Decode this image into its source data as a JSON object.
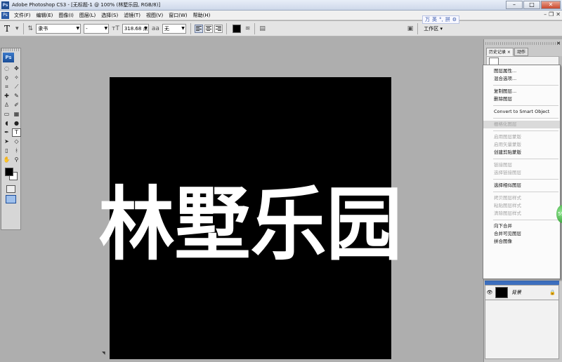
{
  "window": {
    "title": "Adobe Photoshop CS3 - [无标题-1 @ 100% (林墅乐园, RGB/8)]",
    "app_icon": "Ps",
    "buttons": {
      "minimize": "–",
      "maximize": "□",
      "close": "✕"
    }
  },
  "menu": {
    "items": [
      "文件(F)",
      "编辑(E)",
      "图像(I)",
      "图层(L)",
      "选择(S)",
      "滤镜(T)",
      "视图(V)",
      "窗口(W)",
      "帮助(H)"
    ],
    "window_controls": [
      "–",
      "❐",
      "✕"
    ]
  },
  "options_bar": {
    "tool_glyph": "T",
    "font_family": "隶书",
    "font_style": "-",
    "font_size": "318.68 点",
    "antialias": "无",
    "workspace": "工作区"
  },
  "ime_bar": {
    "items": [
      "万",
      "英",
      "°,",
      "拼",
      "⚙"
    ]
  },
  "toolbox": {
    "badge": "Ps"
  },
  "canvas": {
    "text": "林墅乐园",
    "background": "#000000",
    "text_color": "#ffffff"
  },
  "panels": {
    "tabs": [
      "历史记录 ×",
      "动作"
    ],
    "close": "✕",
    "layer_name": "背景",
    "layer_lock": "🔒"
  },
  "context_menu": {
    "groups": [
      [
        {
          "label": "图层属性...",
          "enabled": true
        },
        {
          "label": "混合选项...",
          "enabled": true
        }
      ],
      [
        {
          "label": "复制图层...",
          "enabled": true
        },
        {
          "label": "删除图层",
          "enabled": true
        }
      ],
      [
        {
          "label": "Convert to Smart Object",
          "enabled": true
        }
      ],
      [
        {
          "label": "栅格化图层",
          "enabled": false,
          "highlighted": true
        }
      ],
      [
        {
          "label": "启用图层蒙版",
          "enabled": false
        },
        {
          "label": "启用矢量蒙版",
          "enabled": false
        },
        {
          "label": "创建剪贴蒙版",
          "enabled": true
        }
      ],
      [
        {
          "label": "链接图层",
          "enabled": false
        },
        {
          "label": "选择链接图层",
          "enabled": false
        }
      ],
      [
        {
          "label": "选择相似图层",
          "enabled": true
        }
      ],
      [
        {
          "label": "拷贝图层样式",
          "enabled": false
        },
        {
          "label": "粘贴图层样式",
          "enabled": false
        },
        {
          "label": "清除图层样式",
          "enabled": false
        }
      ],
      [
        {
          "label": "向下合并",
          "enabled": true
        },
        {
          "label": "合并可见图层",
          "enabled": true
        },
        {
          "label": "拼合图像",
          "enabled": true
        }
      ]
    ]
  },
  "orb_label": "59"
}
